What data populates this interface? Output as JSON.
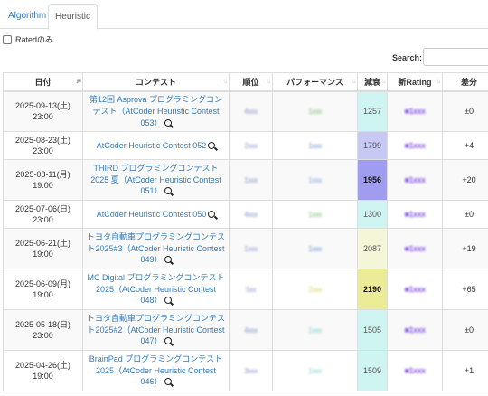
{
  "tabs": [
    {
      "label": "Algorithm",
      "active": false
    },
    {
      "label": "Heuristic",
      "active": true
    }
  ],
  "filter": {
    "rated_only_label": "Ratedのみ",
    "checked": false
  },
  "search": {
    "label": "Search:",
    "value": ""
  },
  "table": {
    "headers": [
      "日付",
      "コンテスト",
      "順位",
      "パフォーマンス",
      "減衰",
      "新Rating",
      "差分"
    ],
    "sorted_column": "日付",
    "rows": [
      {
        "date": "2025-09-13(土)",
        "time": "23:00",
        "contest": "第12回 Asprova プログラミングコンテスト（AtCoder Heuristic Contest 053）",
        "rank": "4xxx",
        "perf": "1xxx",
        "perf_color": "#7fbf7f",
        "decay": "1257",
        "decay_bg": "#cff5f3",
        "decay_bold": false,
        "new_rating": "■1xxx",
        "new_rating_color": "#8c5ce6",
        "diff": "±0"
      },
      {
        "date": "2025-08-23(土)",
        "time": "23:00",
        "contest": "AtCoder Heuristic Contest 052",
        "rank": "2xxx",
        "perf": "1xxx",
        "perf_color": "#6a90cf",
        "decay": "1799",
        "decay_bg": "#c8c8f5",
        "decay_bold": false,
        "new_rating": "■1xxx",
        "new_rating_color": "#8c5ce6",
        "diff": "+4"
      },
      {
        "date": "2025-08-11(月)",
        "time": "19:00",
        "contest": "THIRD プログラミングコンテスト 2025 夏（AtCoder Heuristic Contest 051）",
        "rank": "1xxx",
        "perf": "1xxx",
        "perf_color": "#8aa4dc",
        "decay": "1956",
        "decay_bg": "#a09cf0",
        "decay_bold": true,
        "new_rating": "■1xxx",
        "new_rating_color": "#8c5ce6",
        "diff": "+20"
      },
      {
        "date": "2025-07-06(日)",
        "time": "23:00",
        "contest": "AtCoder Heuristic Contest 050",
        "rank": "4xxx",
        "perf": "1xxx",
        "perf_color": "#7fbf7f",
        "decay": "1300",
        "decay_bg": "#cff5f3",
        "decay_bold": false,
        "new_rating": "■1xxx",
        "new_rating_color": "#8c5ce6",
        "diff": "±0"
      },
      {
        "date": "2025-06-21(土)",
        "time": "19:00",
        "contest": "トヨタ自動車プログラミングコンテスト2025#3（AtCoder Heuristic Contest 049）",
        "rank": "1xxx",
        "perf": "1xxx",
        "perf_color": "#6a90cf",
        "decay": "2087",
        "decay_bg": "#f5f5d8",
        "decay_bold": false,
        "new_rating": "■1xxx",
        "new_rating_color": "#8c5ce6",
        "diff": "+19"
      },
      {
        "date": "2025-06-09(月)",
        "time": "19:00",
        "contest": "MC Digital プログラミングコンテスト2025（AtCoder Heuristic Contest 048）",
        "rank": "5xx",
        "perf": "2xxx",
        "perf_color": "#d8d860",
        "decay": "2190",
        "decay_bg": "#ecec98",
        "decay_bold": true,
        "new_rating": "■1xxx",
        "new_rating_color": "#8c5ce6",
        "diff": "+65"
      },
      {
        "date": "2025-05-18(日)",
        "time": "23:00",
        "contest": "トヨタ自動車プログラミングコンテスト2025#2（AtCoder Heuristic Contest 047）",
        "rank": "4xxx",
        "perf": "1xxx",
        "perf_color": "#7fd0d0",
        "decay": "1505",
        "decay_bg": "#cff5f3",
        "decay_bold": false,
        "new_rating": "■1xxx",
        "new_rating_color": "#8c5ce6",
        "diff": "±0"
      },
      {
        "date": "2025-04-26(土)",
        "time": "19:00",
        "contest": "BrainPad プログラミングコンテスト 2025（AtCoder Heuristic Contest 046）",
        "rank": "3xxx",
        "perf": "1xxx",
        "perf_color": "#7fd0d0",
        "decay": "1509",
        "decay_bg": "#cff5f3",
        "decay_bold": false,
        "new_rating": "■1xxx",
        "new_rating_color": "#8c5ce6",
        "diff": "+1"
      }
    ]
  }
}
